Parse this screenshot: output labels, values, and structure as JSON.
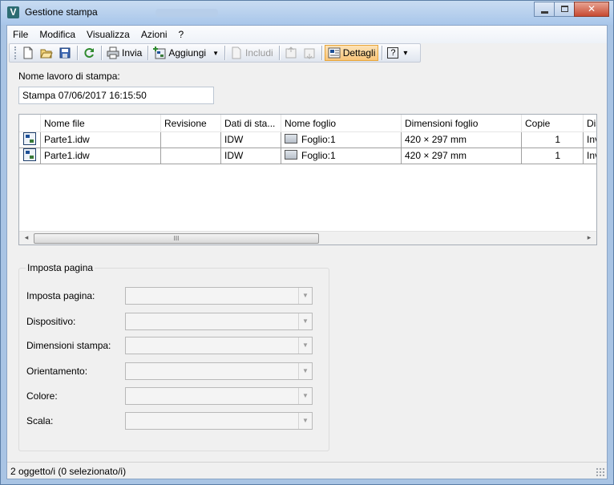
{
  "window": {
    "title": "Gestione stampa",
    "app_icon_letter": "V",
    "buttons": {
      "minimize": "minimize-icon",
      "maximize": "maximize-icon",
      "close": "✕"
    }
  },
  "menu": {
    "items": [
      "File",
      "Modifica",
      "Visualizza",
      "Azioni",
      "?"
    ]
  },
  "toolbar": {
    "invia": "Invia",
    "aggiungi": "Aggiungi",
    "aggiungi_arrow": "▼",
    "includi": "Includi",
    "dettagli": "Dettagli",
    "help": "?",
    "overflow": "▾"
  },
  "job": {
    "label": "Nome lavoro di stampa:",
    "value": "Stampa 07/06/2017 16:15:50"
  },
  "list": {
    "columns": [
      "Nome file",
      "Revisione",
      "Dati di sta...",
      "Nome foglio",
      "Dimensioni foglio",
      "Copie",
      "Dis"
    ],
    "rows": [
      {
        "file": "Parte1.idw",
        "revision": "",
        "data": "IDW",
        "sheet": "Foglio:1",
        "size": "420 × 297 mm",
        "copies": "1",
        "dis": "Inv"
      },
      {
        "file": "Parte1.idw",
        "revision": "",
        "data": "IDW",
        "sheet": "Foglio:1",
        "size": "420 × 297 mm",
        "copies": "1",
        "dis": "Inv"
      }
    ],
    "scroll_left": "◂",
    "scroll_right": "▸",
    "thumb_grip": "III"
  },
  "page_setup": {
    "title": "Imposta pagina",
    "fields": [
      {
        "label": "Imposta pagina:",
        "value": ""
      },
      {
        "label": "Dispositivo:",
        "value": ""
      },
      {
        "label": "Dimensioni stampa:",
        "value": ""
      },
      {
        "label": "Orientamento:",
        "value": ""
      },
      {
        "label": "Colore:",
        "value": ""
      },
      {
        "label": "Scala:",
        "value": ""
      }
    ],
    "dropdown_arrow": "▼"
  },
  "status": {
    "text": "2 oggetto/i (0 selezionato/i)"
  },
  "colors": {
    "titlebar": "#a8c6ea",
    "pressed_button": "#f9c57a",
    "close_button": "#c74a32"
  }
}
